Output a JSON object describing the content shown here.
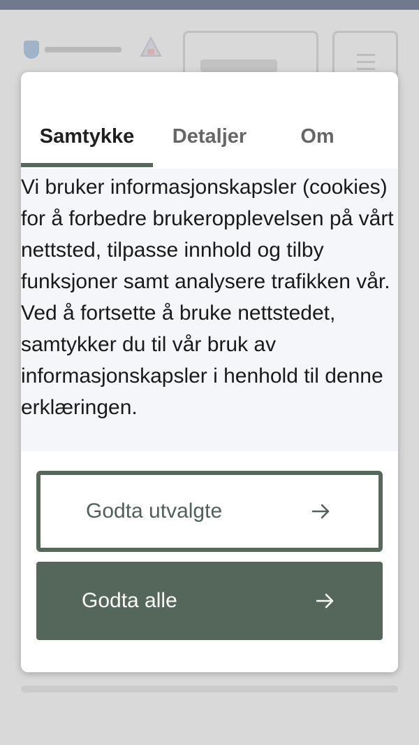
{
  "dialog": {
    "tabs": [
      {
        "label": "Samtykke",
        "active": true
      },
      {
        "label": "Detaljer",
        "active": false
      },
      {
        "label": "Om",
        "active": false
      }
    ],
    "body_text": "Vi bruker informasjonskapsler (cookies) for å forbedre brukeropplevelsen på vårt nettsted, tilpasse innhold og tilby funksjoner samt analysere trafikken vår. Ved å fortsette å bruke nettstedet, samtykker du til vår bruk av informasjonskapsler i henhold til denne erklæringen.",
    "buttons": {
      "accept_selected": {
        "label": "Godta utvalgte",
        "icon": "arrow-right-icon"
      },
      "accept_all": {
        "label": "Godta alle",
        "icon": "arrow-right-icon"
      }
    }
  },
  "colors": {
    "accent": "#56685a",
    "tab_active_text": "#1f1f1f",
    "tab_inactive_text": "#666666",
    "body_background": "#f4f6f9",
    "overlay_background": "#d9d9d9",
    "header_bar": "#6f7a8c"
  }
}
